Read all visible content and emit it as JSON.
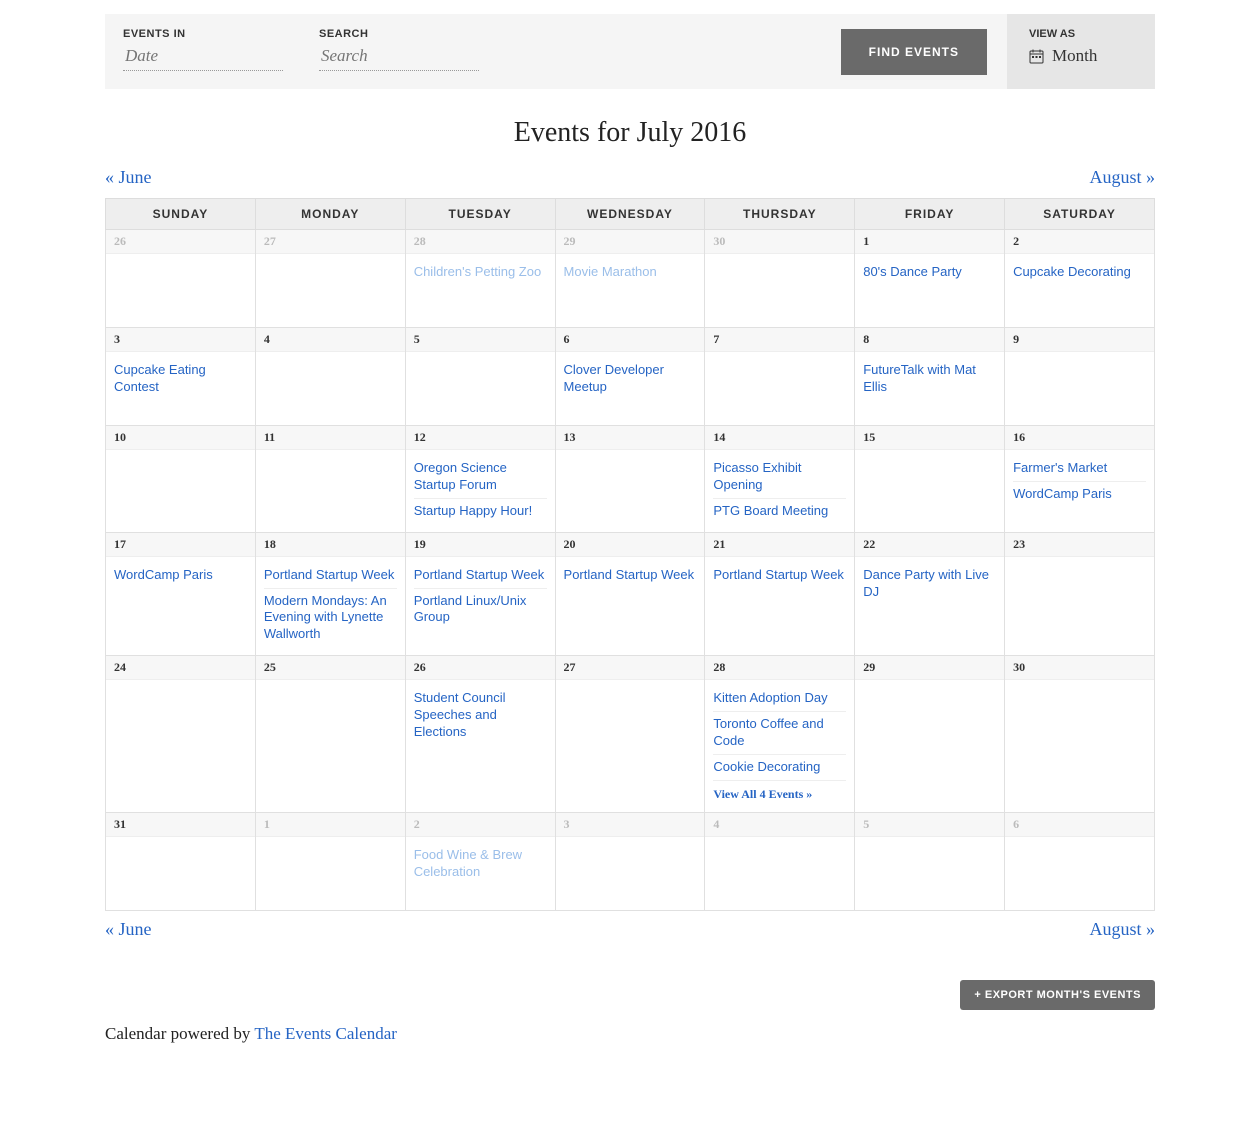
{
  "filterBar": {
    "eventsInLabel": "EVENTS IN",
    "eventsInPlaceholder": "Date",
    "searchLabel": "SEARCH",
    "searchPlaceholder": "Search",
    "findButton": "FIND EVENTS",
    "viewAsLabel": "VIEW AS",
    "viewAsValue": "Month"
  },
  "title": "Events for July 2016",
  "nav": {
    "prevLabel": "« June",
    "nextLabel": "August »"
  },
  "weekdays": [
    "SUNDAY",
    "MONDAY",
    "TUESDAY",
    "WEDNESDAY",
    "THURSDAY",
    "FRIDAY",
    "SATURDAY"
  ],
  "weeks": [
    [
      {
        "num": "26",
        "other": true,
        "events": []
      },
      {
        "num": "27",
        "other": true,
        "events": []
      },
      {
        "num": "28",
        "other": true,
        "events": [
          "Children's Petting Zoo"
        ]
      },
      {
        "num": "29",
        "other": true,
        "events": [
          "Movie Marathon"
        ]
      },
      {
        "num": "30",
        "other": true,
        "events": []
      },
      {
        "num": "1",
        "events": [
          "80's Dance Party"
        ]
      },
      {
        "num": "2",
        "events": [
          "Cupcake Decorating"
        ]
      }
    ],
    [
      {
        "num": "3",
        "events": [
          "Cupcake Eating Contest"
        ]
      },
      {
        "num": "4",
        "events": []
      },
      {
        "num": "5",
        "events": []
      },
      {
        "num": "6",
        "events": [
          "Clover Developer Meetup"
        ]
      },
      {
        "num": "7",
        "events": []
      },
      {
        "num": "8",
        "events": [
          "FutureTalk with Mat Ellis"
        ]
      },
      {
        "num": "9",
        "events": []
      }
    ],
    [
      {
        "num": "10",
        "events": []
      },
      {
        "num": "11",
        "events": []
      },
      {
        "num": "12",
        "events": [
          "Oregon Science Startup Forum",
          "Startup Happy Hour!"
        ]
      },
      {
        "num": "13",
        "events": []
      },
      {
        "num": "14",
        "events": [
          "Picasso Exhibit Opening",
          "PTG Board Meeting"
        ]
      },
      {
        "num": "15",
        "events": []
      },
      {
        "num": "16",
        "events": [
          "Farmer's Market",
          "WordCamp Paris"
        ]
      }
    ],
    [
      {
        "num": "17",
        "events": [
          "WordCamp Paris"
        ]
      },
      {
        "num": "18",
        "events": [
          "Portland Startup Week",
          "Modern Mondays: An Evening with Lynette Wallworth"
        ]
      },
      {
        "num": "19",
        "events": [
          "Portland Startup Week",
          "Portland Linux/Unix Group"
        ]
      },
      {
        "num": "20",
        "events": [
          "Portland Startup Week"
        ]
      },
      {
        "num": "21",
        "events": [
          "Portland Startup Week"
        ]
      },
      {
        "num": "22",
        "events": [
          "Dance Party with Live DJ"
        ]
      },
      {
        "num": "23",
        "events": []
      }
    ],
    [
      {
        "num": "24",
        "events": []
      },
      {
        "num": "25",
        "events": []
      },
      {
        "num": "26",
        "events": [
          "Student Council Speeches and Elections"
        ]
      },
      {
        "num": "27",
        "events": []
      },
      {
        "num": "28",
        "events": [
          "Kitten Adoption Day",
          "Toronto Coffee and Code",
          "Cookie Decorating"
        ],
        "viewAll": "View All 4 Events »"
      },
      {
        "num": "29",
        "events": []
      },
      {
        "num": "30",
        "events": []
      }
    ],
    [
      {
        "num": "31",
        "events": []
      },
      {
        "num": "1",
        "other": true,
        "events": []
      },
      {
        "num": "2",
        "other": true,
        "events": [
          "Food Wine & Brew Celebration"
        ]
      },
      {
        "num": "3",
        "other": true,
        "events": []
      },
      {
        "num": "4",
        "other": true,
        "events": []
      },
      {
        "num": "5",
        "other": true,
        "events": []
      },
      {
        "num": "6",
        "other": true,
        "events": []
      }
    ]
  ],
  "exportLabel": "+ EXPORT MONTH'S EVENTS",
  "powered": {
    "text": "Calendar powered by ",
    "linkText": "The Events Calendar"
  }
}
